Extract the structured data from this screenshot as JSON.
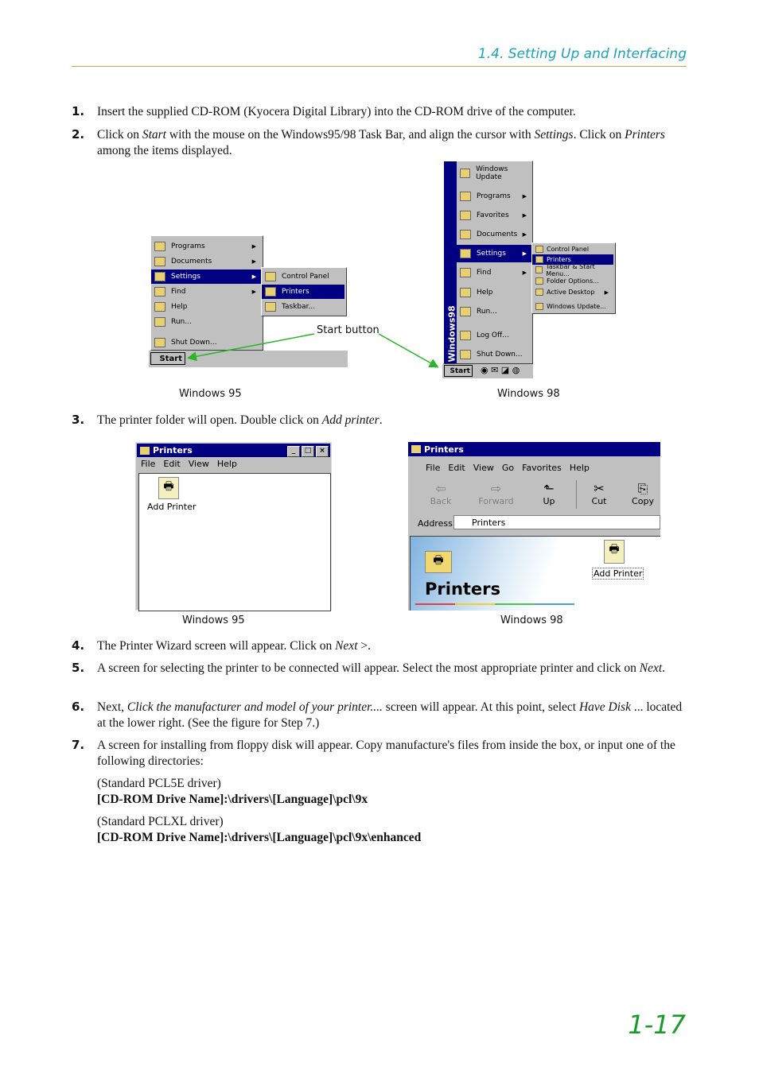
{
  "header": {
    "section_title": "1.4. Setting Up and Interfacing"
  },
  "steps": [
    {
      "num": "1.",
      "text": "Insert the supplied CD-ROM (Kyocera Digital Library) into the CD-ROM drive of the computer."
    },
    {
      "num": "2.",
      "text_parts": [
        "Click on ",
        "Start",
        " with the mouse on the Windows95/98 Task Bar, and align the cursor with ",
        "Settings",
        ". Click on ",
        "Printers",
        " among the items displayed."
      ]
    },
    {
      "num": "3.",
      "text_parts": [
        "The printer folder will open.  Double click on ",
        "Add printer",
        "."
      ]
    },
    {
      "num": "4.",
      "text_parts": [
        "The Printer Wizard screen will appear.  Click on ",
        "Next",
        " >."
      ]
    },
    {
      "num": "5.",
      "text_parts": [
        "A screen for selecting the printer to be connected will appear.  Select the most appropriate printer and click on ",
        "Next",
        "."
      ]
    },
    {
      "num": "6.",
      "text_parts": [
        "Next, ",
        "Click the manufacturer and model of your printer....",
        " screen will appear.  At this point, select ",
        "Have Disk",
        " ... located at the lower right.  (See the figure for Step 7.)"
      ]
    },
    {
      "num": "7.",
      "text": "A screen for installing from floppy disk will appear. Copy manufacture's files from inside the box, or input one of the following directories:",
      "drivers": [
        {
          "label": "(Standard PCL5E driver)",
          "path": "[CD-ROM Drive Name]:\\drivers\\[Language]\\pcl\\9x"
        },
        {
          "label": "(Standard PCLXL driver)",
          "path": "[CD-ROM Drive Name]:\\drivers\\[Language]\\pcl\\9x\\enhanced"
        }
      ]
    }
  ],
  "figure1": {
    "win95_caption": "Windows 95",
    "win98_caption": "Windows 98",
    "callout": "Start button",
    "win95_menu": [
      "Programs",
      "Documents",
      "Settings",
      "Find",
      "Help",
      "Run...",
      "Shut Down..."
    ],
    "win95_submenu": [
      "Control Panel",
      "Printers",
      "Taskbar..."
    ],
    "win95_start": "Start",
    "win98_menu": [
      "Windows Update",
      "Programs",
      "Favorites",
      "Documents",
      "Settings",
      "Find",
      "Help",
      "Run...",
      "Log Off...",
      "Shut Down..."
    ],
    "win98_submenu": [
      "Control Panel",
      "Printers",
      "Taskbar & Start Menu...",
      "Folder Options...",
      "Active Desktop",
      "Windows Update..."
    ],
    "win98_banner": "Windows98",
    "win98_start": "Start"
  },
  "figure2": {
    "win95_caption": "Windows 95",
    "win98_caption": "Windows 98",
    "win95": {
      "title": "Printers",
      "menu": [
        "File",
        "Edit",
        "View",
        "Help"
      ],
      "icon_label": "Add Printer"
    },
    "win98": {
      "title": "Printers",
      "menu": [
        "File",
        "Edit",
        "View",
        "Go",
        "Favorites",
        "Help"
      ],
      "toolbar": [
        "Back",
        "Forward",
        "Up",
        "Cut",
        "Copy"
      ],
      "address_label": "Address",
      "address_value": "Printers",
      "heading": "Printers",
      "icon_label": "Add Printer"
    }
  },
  "footer": {
    "page_number": "1-17"
  }
}
